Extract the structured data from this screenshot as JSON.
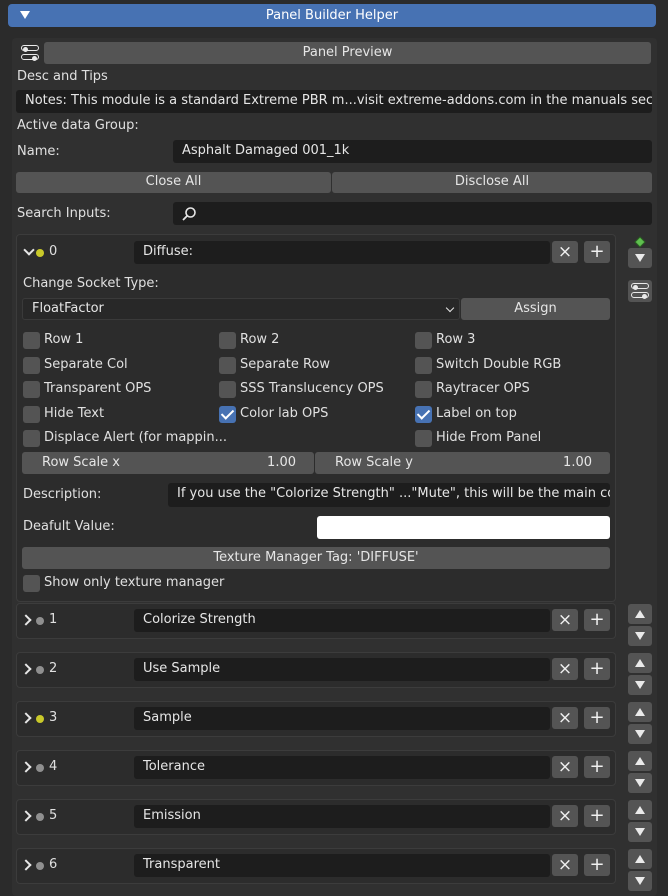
{
  "panel": {
    "title": "Panel Builder Helper"
  },
  "preview": {
    "label": "Panel Preview"
  },
  "desc": {
    "heading": "Desc and Tips",
    "notes": "Notes: This module is a standard Extreme PBR m...visit extreme-addons.com in the manuals section."
  },
  "group": {
    "heading": "Active data Group:",
    "name_label": "Name:",
    "name_value": "Asphalt Damaged 001_1k"
  },
  "actions": {
    "close_all": "Close All",
    "disclose_all": "Disclose All"
  },
  "search": {
    "label": "Search Inputs:",
    "value": ""
  },
  "socket0": {
    "index": "0",
    "name": "Diffuse:",
    "dot_color": "#c9c92a",
    "change_type_label": "Change Socket Type:",
    "socket_type": "FloatFactor",
    "assign": "Assign",
    "options": [
      {
        "label": "Row 1",
        "checked": false
      },
      {
        "label": "Row 2",
        "checked": false
      },
      {
        "label": "Row 3",
        "checked": false
      },
      {
        "label": "Separate Col",
        "checked": false
      },
      {
        "label": "Separate Row",
        "checked": false
      },
      {
        "label": "Switch Double RGB",
        "checked": false
      },
      {
        "label": "Transparent OPS",
        "checked": false
      },
      {
        "label": "SSS Translucency OPS",
        "checked": false
      },
      {
        "label": "Raytracer OPS",
        "checked": false
      },
      {
        "label": "Hide Text",
        "checked": false
      },
      {
        "label": "Color lab OPS",
        "checked": true
      },
      {
        "label": "Label on top",
        "checked": true
      },
      {
        "label": "Displace Alert (for mappin...",
        "checked": false
      },
      {
        "label": "Hide From Panel",
        "checked": false
      }
    ],
    "row_scale_x_label": "Row Scale x",
    "row_scale_x_value": "1.00",
    "row_scale_y_label": "Row Scale y",
    "row_scale_y_value": "1.00",
    "description_label": "Description:",
    "description_value": "If you use the \"Colorize Strength\" ...\"Mute\", this will be the main color.",
    "default_label": "Deafult Value:",
    "default_color": "#ffffff",
    "tex_tag": "Texture Manager Tag: 'DIFFUSE'",
    "show_only_tex": "Show only texture manager"
  },
  "sockets": [
    {
      "index": "1",
      "name": "Colorize Strength",
      "dot_color": "#8f8f8f"
    },
    {
      "index": "2",
      "name": "Use Sample",
      "dot_color": "#8f8f8f"
    },
    {
      "index": "3",
      "name": "Sample",
      "dot_color": "#c9c92a"
    },
    {
      "index": "4",
      "name": "Tolerance",
      "dot_color": "#8f8f8f"
    },
    {
      "index": "5",
      "name": "Emission",
      "dot_color": "#8f8f8f"
    },
    {
      "index": "6",
      "name": "Transparent",
      "dot_color": "#8f8f8f"
    }
  ],
  "icons": {
    "remove": "×",
    "add": "+",
    "move_up": "up-triangle",
    "move_down": "down-triangle"
  }
}
